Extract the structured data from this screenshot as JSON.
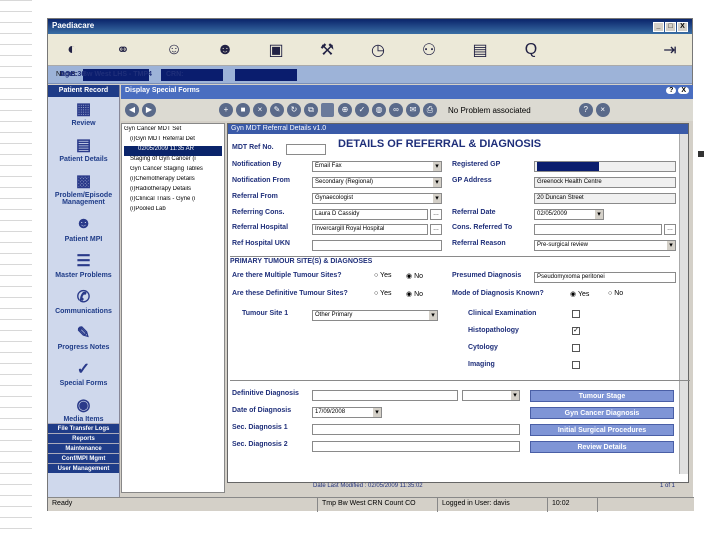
{
  "app_title": "Paediacare",
  "window_buttons": [
    "_",
    "□",
    "X"
  ],
  "toolbar_icons": [
    "binoculars-icon",
    "doctor-icon",
    "nurse-icon",
    "network-icon",
    "tools-icon",
    "pen-icon",
    "clock-icon",
    "people-icon",
    "books-icon",
    "search-icon",
    "exit-icon"
  ],
  "toolbar_search_glyph": "Q",
  "patient_bar": {
    "name_label": "Name:",
    "dob_label": "DOB:",
    "age": "Age: 30",
    "org": "Bw West LHS - TMP4",
    "crn_label": "CRN:"
  },
  "left_nav": {
    "header": "Patient Record",
    "items": [
      {
        "label": "Review",
        "icon": "review-icon"
      },
      {
        "label": "Patient Details",
        "icon": "patient-details-icon"
      },
      {
        "label": "Problem/Episode Management",
        "icon": "problem-icon"
      },
      {
        "label": "Patient MPI",
        "icon": "patient-mpi-icon"
      },
      {
        "label": "Master Problems",
        "icon": "master-problems-icon"
      },
      {
        "label": "Communications",
        "icon": "communications-icon"
      },
      {
        "label": "Progress Notes",
        "icon": "progress-notes-icon"
      },
      {
        "label": "Special Forms",
        "icon": "special-forms-icon"
      },
      {
        "label": "Media Items",
        "icon": "media-items-icon"
      }
    ],
    "bottom_buttons": [
      "File Transfer Logs",
      "Reports",
      "Maintenance",
      "Conf/MPI Mgmt",
      "User Management"
    ]
  },
  "display_title": "Display Special Forms",
  "display_buttons": [
    "?",
    "X"
  ],
  "message": "No Problem associated",
  "tree": [
    "Gyn Cancer MDT Set",
    "(i)Gyn MDT Referral Det",
    "02/05/2009 11:35 AR",
    "Staging of Gyn Cancer (i",
    "Gyn Cancer Staging Tables",
    "(i)Chemotherapy Details",
    "(i)Radiotherapy Details",
    "(i)Clinical Trials - Gyne (i",
    "(i)Pooled Lab"
  ],
  "form": {
    "title": "Gyn MDT Referral Details v1.0",
    "heading": "DETAILS OF REFERRAL & DIAGNOSIS",
    "mdt_ref_label": "MDT Ref No.",
    "notified_by_label": "Notification By",
    "notified_by_value": "Email Fax",
    "notified_from_label": "Notification From",
    "notified_from_value": "Secondary (Regional)",
    "referral_from_label": "Referral From",
    "referral_from_value": "Gynaecologist",
    "referring_cons_label": "Referring Cons.",
    "referring_cons_value": "Laura D Cassidy",
    "referral_hospital_label": "Referral Hospital",
    "referral_hospital_value": "Invercargill Royal Hospital",
    "ref_ukn_label": "Ref Hospital UKN",
    "registered_gp_label": "Registered GP",
    "gp_address_label": "GP Address",
    "gp_address_line1": "Greenock Health Centre",
    "gp_address_line2": "20 Duncan Street",
    "referral_date_label": "Referral Date",
    "referral_date_value": "02/05/2009",
    "cons_referred_label": "Cons. Referred To",
    "referral_reason_label": "Referral Reason",
    "referral_reason_value": "Pre-surgical review",
    "primary_section": "PRIMARY TUMOUR SITE(S) & DIAGNOSES",
    "multiple_sites_label": "Are there Multiple Tumour Sites?",
    "definitive_sites_label": "Are these Definitive Tumour Sites?",
    "tumour_site1_label": "Tumour Site 1",
    "tumour_site1_value": "Other Primary",
    "presumed_dx_label": "Presumed Diagnosis",
    "presumed_dx_value": "Pseudomyxoma peritonei",
    "mode_dx_label": "Mode of Diagnosis Known?",
    "yes_label": "Yes",
    "no_label": "No",
    "clinical_exam_label": "Clinical Examination",
    "histopathology_label": "Histopathology",
    "cytology_label": "Cytology",
    "imaging_label": "Imaging",
    "definitive_dx_label": "Definitive Diagnosis",
    "date_dx_label": "Date of Diagnosis",
    "date_dx_value": "17/09/2008",
    "sec_dx1_label": "Sec. Diagnosis 1",
    "sec_dx2_label": "Sec. Diagnosis 2",
    "btn_tumour_stage": "Tumour Stage",
    "btn_gyn_cancer_dx": "Gyn Cancer Diagnosis",
    "btn_surgical": "Initial Surgical Procedures",
    "btn_review": "Review Details",
    "date_last_modified": "Date Last Modified : 02/05/2009 11:35:02",
    "page_count": "1 of 1"
  },
  "status_bar": [
    "Ready",
    "Tmp Bw West CRN Count CO",
    "Logged in User: davis",
    "10:02"
  ]
}
